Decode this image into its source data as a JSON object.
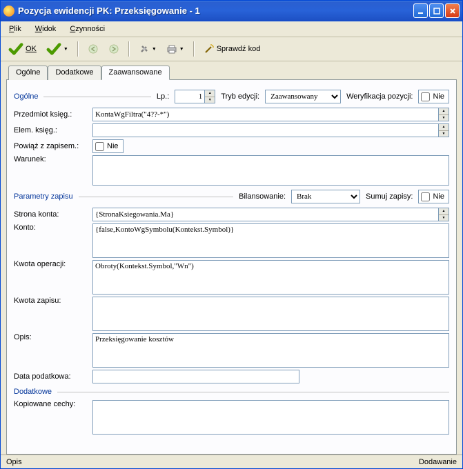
{
  "window": {
    "title": "Pozycja ewidencji PK: Przeksięgowanie - 1"
  },
  "menu": {
    "plik": "Plik",
    "widok": "Widok",
    "czynnosci": "Czynności"
  },
  "toolbar": {
    "ok": "OK",
    "sprawdz": "Sprawdź kod"
  },
  "tabs": {
    "ogolne": "Ogólne",
    "dodatkowe": "Dodatkowe",
    "zaawansowane": "Zaawansowane"
  },
  "groups": {
    "ogolne": "Ogólne",
    "parametry": "Parametry zapisu",
    "dodatkowe": "Dodatkowe"
  },
  "labels": {
    "lp": "Lp.:",
    "tryb": "Tryb edycji:",
    "weryfikacja": "Weryfikacja pozycji:",
    "przedmiot": "Przedmiot księg.:",
    "elem": "Elem. księg.:",
    "powiaz": "Powiąż z zapisem.:",
    "warunek": "Warunek:",
    "bilansowanie": "Bilansowanie:",
    "sumuj": "Sumuj zapisy:",
    "strona": "Strona konta:",
    "konto": "Konto:",
    "kwota_op": "Kwota operacji:",
    "kwota_zap": "Kwota zapisu:",
    "opis": "Opis:",
    "data_pod": "Data podatkowa:",
    "kopiowane": "Kopiowane cechy:"
  },
  "values": {
    "lp": "1",
    "tryb": "Zaawansowany",
    "nie": "Nie",
    "przedmiot": "KontaWgFiltra(\"4??-*\")",
    "elem": "",
    "warunek": "",
    "bilansowanie": "Brak",
    "strona": "{StronaKsiegowania.Ma}",
    "konto": "{false,KontoWgSymbolu(Kontekst.Symbol)}",
    "kwota_op": "Obroty(Kontekst.Symbol,\"Wn\")",
    "kwota_zap": "",
    "opis": "Przeksięgowanie kosztów",
    "data_pod": "",
    "kopiowane": ""
  },
  "status": {
    "left": "Opis",
    "right": "Dodawanie"
  }
}
